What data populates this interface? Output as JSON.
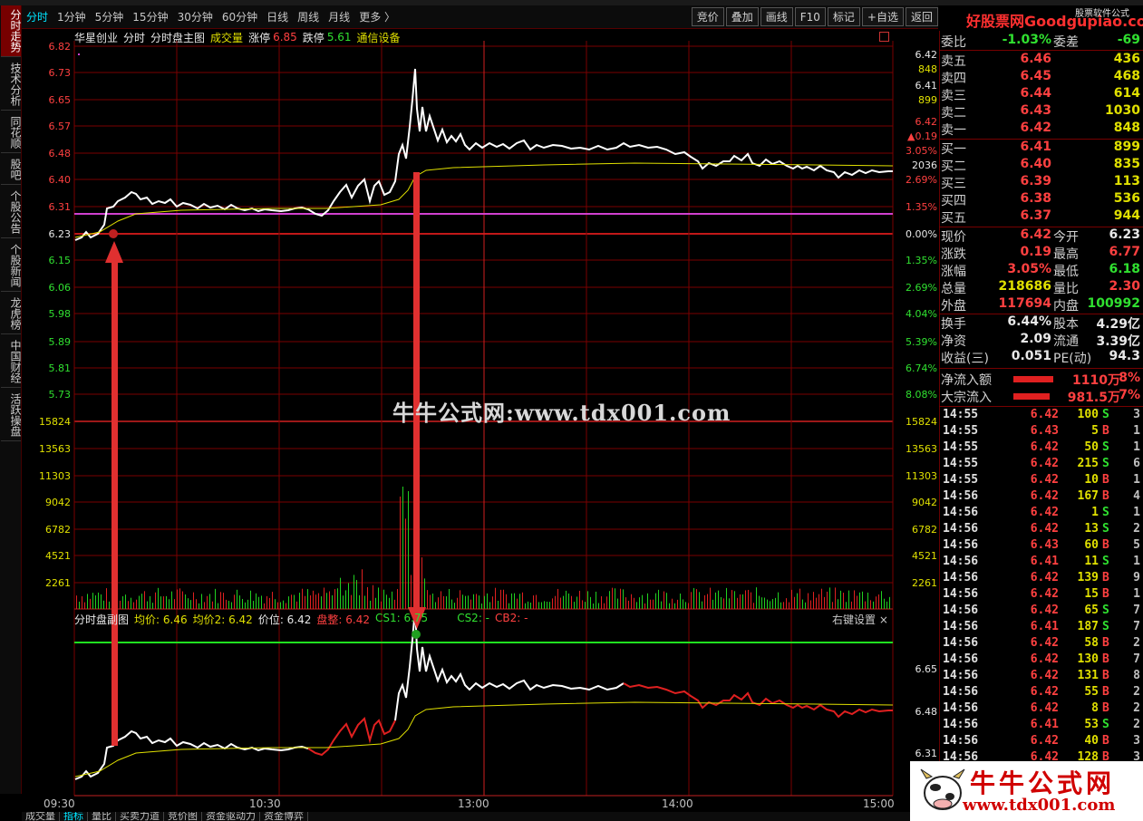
{
  "periods": [
    "分时",
    "1分钟",
    "5分钟",
    "15分钟",
    "30分钟",
    "60分钟",
    "日线",
    "周线",
    "月线",
    "更多 〉"
  ],
  "tools": [
    "竞价",
    "叠加",
    "画线",
    "F10",
    "标记",
    "+自选",
    "返回"
  ],
  "left_tabs": [
    "分时走势",
    "技术分析",
    "同花顺",
    "股吧",
    "个股公告",
    "个股新闻",
    "龙虎榜",
    "中国财经",
    "活跃操盘"
  ],
  "header": {
    "stock": "华星创业",
    "mode": "分时",
    "chart_name": "分时盘主图",
    "vol_label": "成交量",
    "up_limit_label": "涨停",
    "up_limit": "6.85",
    "down_limit_label": "跌停",
    "down_limit": "5.61",
    "sector": "通信设备"
  },
  "price_axis": [
    "6.82",
    "6.73",
    "6.65",
    "6.57",
    "6.48",
    "6.40",
    "6.31",
    "6.23",
    "6.15",
    "6.06",
    "5.98",
    "5.89",
    "5.81",
    "5.73"
  ],
  "pct_axis": [
    "2.69%",
    "1.35%",
    "0.00%",
    "1.35%",
    "2.69%",
    "4.04%",
    "5.39%",
    "6.74%",
    "8.08%"
  ],
  "quote_box": [
    "6.42",
    "848",
    "6.41",
    "899",
    "6.42",
    "▲0.19",
    "3.05%",
    "2036"
  ],
  "vol_axis": [
    "15824",
    "13563",
    "11303",
    "9042",
    "6782",
    "4521",
    "2261"
  ],
  "watermark": "牛牛公式网:www.tdx001.com",
  "sub": {
    "title": "分时盘副图",
    "avg1": "均价: 6.46",
    "avg2": "均价2: 6.42",
    "price": "价位: 6.42",
    "pan": "盘整: 6.42",
    "cs1": "CS1: 6.75",
    "cs2": "CS2: -",
    "cb2": "CB2: -",
    "settings": "右键设置 ×",
    "axis": [
      "6.65",
      "6.48",
      "6.31"
    ]
  },
  "time_axis": [
    "09:30",
    "10:30",
    "13:00",
    "14:00",
    "15:00"
  ],
  "bottom_tabs": [
    "成交量",
    "指标",
    "量比",
    "买卖力道",
    "竞价图",
    "资金驱动力",
    "资金博弈"
  ],
  "brand": {
    "main": "好股票网Goodgupiao.com",
    "sub": "股票软件公式"
  },
  "quote": {
    "weibi": [
      "委比",
      "-1.03%",
      "委差",
      "-69"
    ],
    "asks": [
      [
        "卖五",
        "6.46",
        "436"
      ],
      [
        "卖四",
        "6.45",
        "468"
      ],
      [
        "卖三",
        "6.44",
        "614"
      ],
      [
        "卖二",
        "6.43",
        "1030"
      ],
      [
        "卖一",
        "6.42",
        "848"
      ]
    ],
    "bids": [
      [
        "买一",
        "6.41",
        "899"
      ],
      [
        "买二",
        "6.40",
        "835"
      ],
      [
        "买三",
        "6.39",
        "113"
      ],
      [
        "买四",
        "6.38",
        "536"
      ],
      [
        "买五",
        "6.37",
        "944"
      ]
    ],
    "stats": [
      [
        "现价",
        "6.42",
        "今开",
        "6.23"
      ],
      [
        "涨跌",
        "0.19",
        "最高",
        "6.77"
      ],
      [
        "涨幅",
        "3.05%",
        "最低",
        "6.18"
      ],
      [
        "总量",
        "218686",
        "量比",
        "2.30"
      ],
      [
        "外盘",
        "117694",
        "内盘",
        "100992"
      ]
    ],
    "stats2": [
      [
        "换手",
        "6.44%",
        "股本",
        "4.29亿"
      ],
      [
        "净资",
        "2.09",
        "流通",
        "3.39亿"
      ],
      [
        "收益(三)",
        "0.051",
        "PE(动)",
        "94.3"
      ]
    ],
    "flows": [
      [
        "净流入额",
        "1110万",
        "8%"
      ],
      [
        "大宗流入",
        "981.5万",
        "7%"
      ]
    ]
  },
  "ticks": [
    [
      "14:55",
      "6.42",
      "100",
      "S",
      "3"
    ],
    [
      "14:55",
      "6.43",
      "5",
      "B",
      "1"
    ],
    [
      "14:55",
      "6.42",
      "50",
      "S",
      "1"
    ],
    [
      "14:55",
      "6.42",
      "215",
      "S",
      "6"
    ],
    [
      "14:55",
      "6.42",
      "10",
      "B",
      "1"
    ],
    [
      "14:56",
      "6.42",
      "167",
      "B",
      "4"
    ],
    [
      "14:56",
      "6.42",
      "1",
      "S",
      "1"
    ],
    [
      "14:56",
      "6.42",
      "13",
      "S",
      "2"
    ],
    [
      "14:56",
      "6.43",
      "60",
      "B",
      "5"
    ],
    [
      "14:56",
      "6.41",
      "11",
      "S",
      "1"
    ],
    [
      "14:56",
      "6.42",
      "139",
      "B",
      "9"
    ],
    [
      "14:56",
      "6.42",
      "15",
      "B",
      "1"
    ],
    [
      "14:56",
      "6.42",
      "65",
      "S",
      "7"
    ],
    [
      "14:56",
      "6.41",
      "187",
      "S",
      "7"
    ],
    [
      "14:56",
      "6.42",
      "58",
      "B",
      "2"
    ],
    [
      "14:56",
      "6.42",
      "130",
      "B",
      "7"
    ],
    [
      "14:56",
      "6.42",
      "131",
      "B",
      "8"
    ],
    [
      "14:56",
      "6.42",
      "55",
      "B",
      "2"
    ],
    [
      "14:56",
      "6.42",
      "8",
      "B",
      "2"
    ],
    [
      "14:56",
      "6.41",
      "53",
      "S",
      "2"
    ],
    [
      "14:56",
      "6.42",
      "40",
      "B",
      "3"
    ],
    [
      "14:56",
      "6.42",
      "128",
      "B",
      "3"
    ]
  ],
  "logo": {
    "t1": "牛牛公式网",
    "t2": "www.tdx001.com"
  },
  "colors": {
    "up": "#ff4040",
    "down": "#30e030",
    "grid": "#8b0000",
    "price_line": "#ffffff",
    "avg_line": "#e0e000",
    "open_line": "#d040d0"
  }
}
